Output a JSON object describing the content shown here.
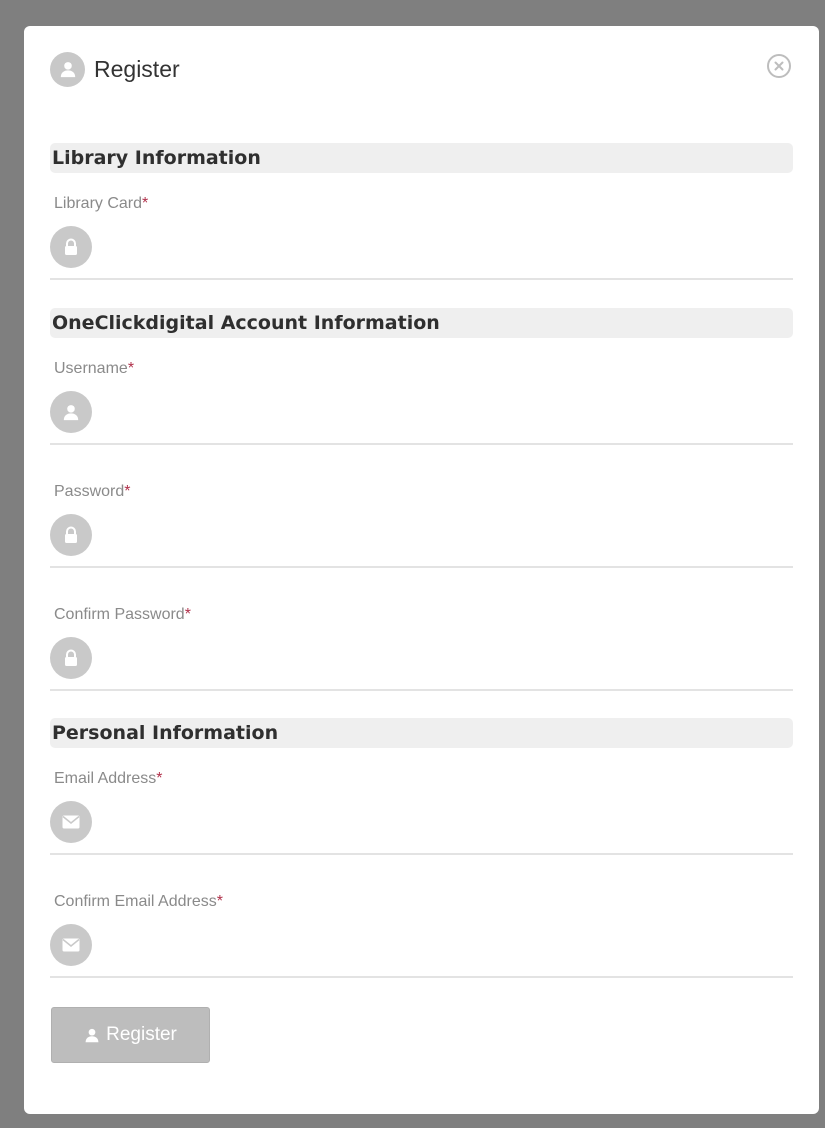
{
  "dialog": {
    "title": "Register",
    "header_icon": "user-icon",
    "close_icon": "close-circle-icon"
  },
  "sections": {
    "library": {
      "title": "Library Information",
      "fields": {
        "library_card": {
          "label": "Library Card",
          "required": "*",
          "value": "",
          "icon": "lock-icon"
        }
      }
    },
    "account": {
      "title": "OneClickdigital Account Information",
      "fields": {
        "username": {
          "label": "Username",
          "required": "*",
          "value": "",
          "icon": "user-icon"
        },
        "password": {
          "label": "Password",
          "required": "*",
          "value": "",
          "icon": "lock-icon"
        },
        "confirm_password": {
          "label": "Confirm Password",
          "required": "*",
          "value": "",
          "icon": "lock-icon"
        }
      }
    },
    "personal": {
      "title": "Personal Information",
      "fields": {
        "email": {
          "label": "Email Address",
          "required": "*",
          "value": "",
          "icon": "envelope-icon"
        },
        "confirm_email": {
          "label": "Confirm Email Address",
          "required": "*",
          "value": "",
          "icon": "envelope-icon"
        }
      }
    }
  },
  "submit": {
    "label": "Register",
    "icon": "user-icon"
  },
  "colors": {
    "backdrop": "#7f7f7f",
    "section_background": "#efefef",
    "required_marker": "#b0304a",
    "icon_gray": "#c9c9c9",
    "button_gray": "#bdbdbd"
  }
}
